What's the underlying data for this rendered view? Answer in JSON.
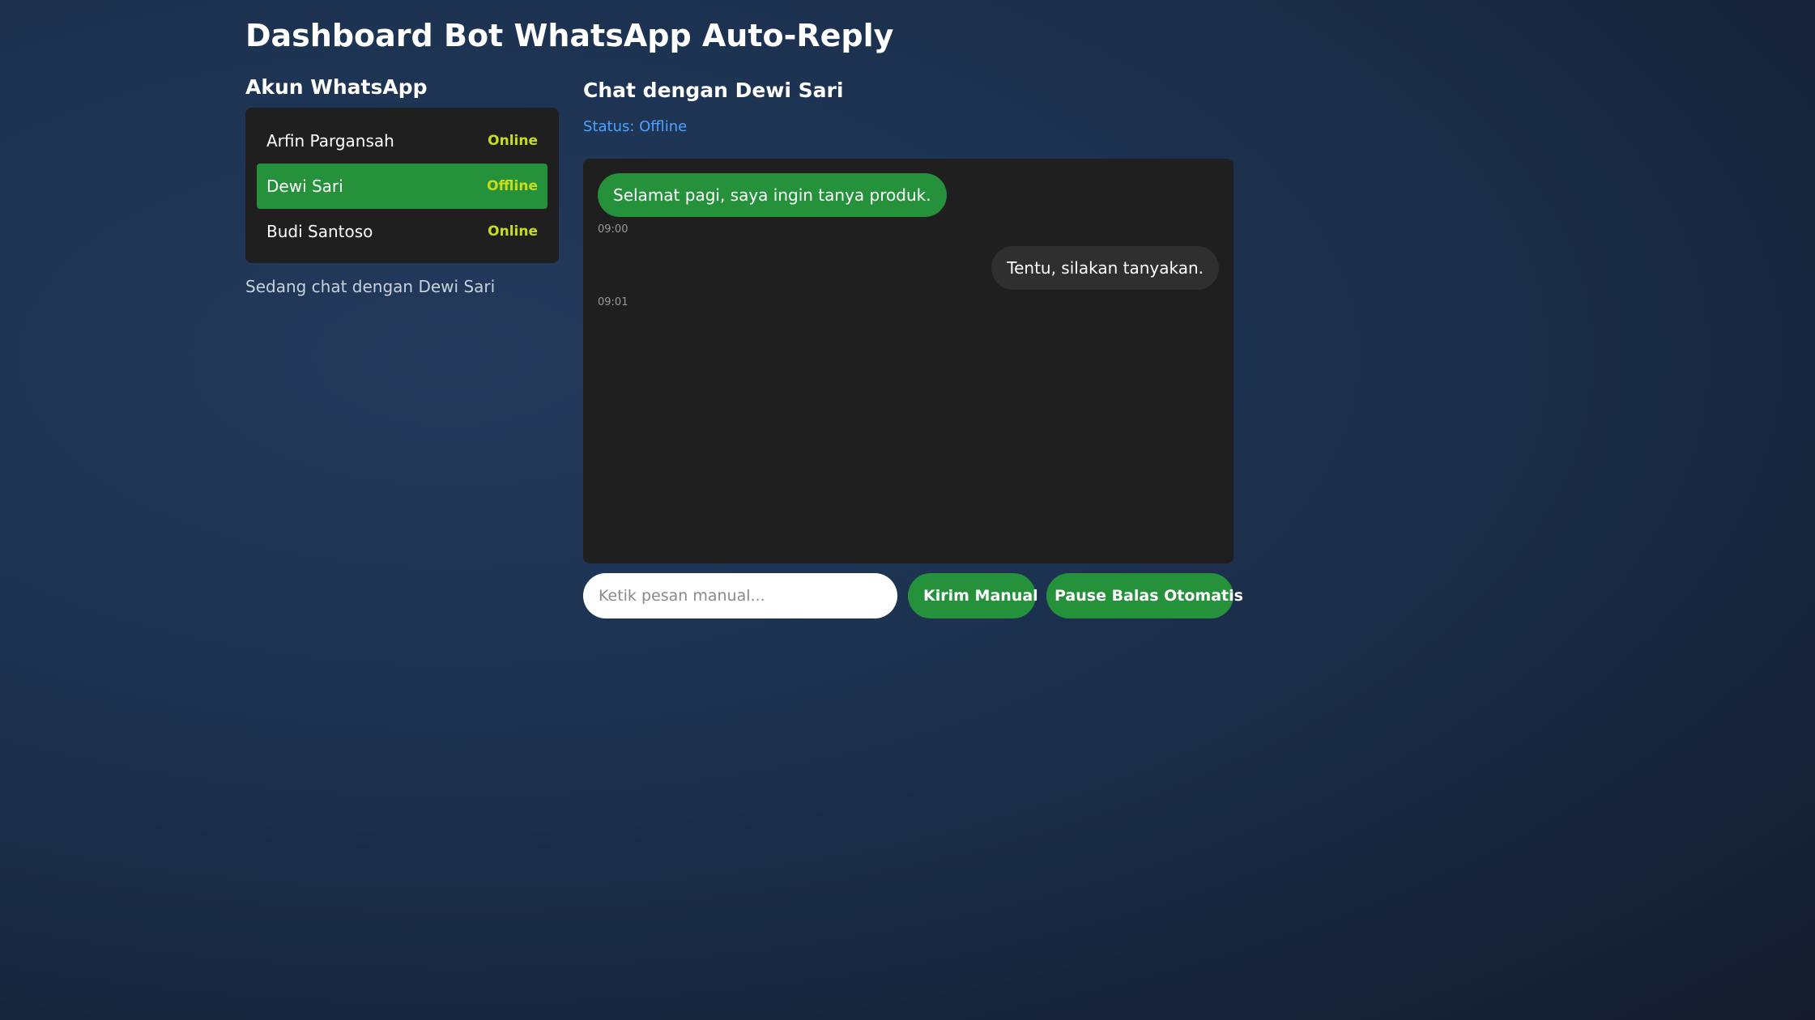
{
  "page": {
    "title": "Dashboard Bot WhatsApp Auto-Reply"
  },
  "accounts": {
    "title": "Akun WhatsApp",
    "items": [
      {
        "name": "Arfin Pargansah",
        "status": "Online",
        "active": false
      },
      {
        "name": "Dewi Sari",
        "status": "Offline",
        "active": true
      },
      {
        "name": "Budi Santoso",
        "status": "Online",
        "active": false
      }
    ],
    "chatting_with": "Sedang chat dengan Dewi Sari"
  },
  "chat": {
    "title": "Chat dengan Dewi Sari",
    "status": "Status: Offline",
    "messages": [
      {
        "text": "Selamat pagi, saya ingin tanya produk.",
        "time": "09:00",
        "direction": "incoming"
      },
      {
        "text": "Tentu, silakan tanyakan.",
        "time": "09:01",
        "direction": "outgoing"
      }
    ]
  },
  "composer": {
    "placeholder": "Ketik pesan manual...",
    "value": "",
    "send_label": "Kirim Manual",
    "pause_label": "Pause Balas Otomatis"
  },
  "colors": {
    "accent_green": "#25913b",
    "status_yellow": "#c8dc1e",
    "status_blue": "#4da3ff",
    "panel_bg": "#1f1f1f"
  }
}
